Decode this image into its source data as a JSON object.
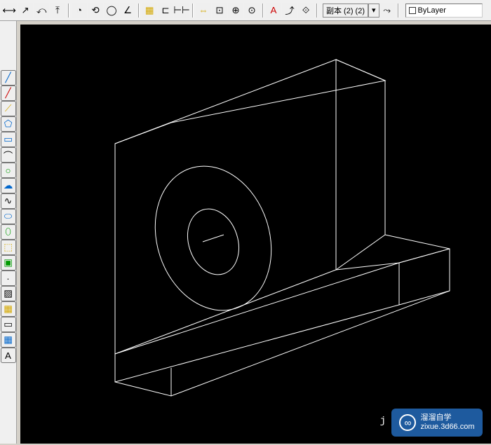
{
  "top_toolbar": {
    "buttons": [
      {
        "name": "dim-linear-icon",
        "glyph": "⟷"
      },
      {
        "name": "dim-aligned-icon",
        "glyph": "↗"
      },
      {
        "name": "dim-arc-icon",
        "glyph": "⤺"
      },
      {
        "name": "dim-ordinate-icon",
        "glyph": "⤒"
      },
      {
        "name": "dim-radius-icon",
        "glyph": "◔"
      },
      {
        "name": "dim-jogged-icon",
        "glyph": "⟲"
      },
      {
        "name": "dim-diameter-icon",
        "glyph": "◯"
      },
      {
        "name": "dim-angular-icon",
        "glyph": "∠"
      },
      {
        "name": "quick-dim-icon",
        "glyph": "▦"
      },
      {
        "name": "dim-baseline-icon",
        "glyph": "⊏"
      },
      {
        "name": "dim-continue-icon",
        "glyph": "⊢⊢"
      },
      {
        "name": "dim-space-icon",
        "glyph": "⇔"
      },
      {
        "name": "dim-break-icon",
        "glyph": "⊡"
      },
      {
        "name": "tolerance-icon",
        "glyph": "⊕"
      },
      {
        "name": "center-mark-icon",
        "glyph": "⊙"
      },
      {
        "name": "dim-edit-icon",
        "glyph": "A"
      },
      {
        "name": "dim-tedit-icon",
        "glyph": "⤴"
      },
      {
        "name": "dim-update-icon",
        "glyph": "⟐"
      }
    ],
    "style_dropdown": {
      "label": "副本 (2) (2)",
      "arrow": "▾"
    },
    "brush_btn": {
      "name": "dim-style-icon",
      "glyph": "⤳"
    },
    "layer_dropdown": {
      "label": "ByLayer",
      "arrow": "▾"
    }
  },
  "left_toolbar": {
    "buttons": [
      {
        "name": "line-icon",
        "glyph": "╱"
      },
      {
        "name": "construction-line-icon",
        "glyph": "╱"
      },
      {
        "name": "polyline-icon",
        "glyph": "⟋"
      },
      {
        "name": "polygon-icon",
        "glyph": "⬠"
      },
      {
        "name": "rectangle-icon",
        "glyph": "▭"
      },
      {
        "name": "arc-icon",
        "glyph": "⌒"
      },
      {
        "name": "circle-icon",
        "glyph": "○"
      },
      {
        "name": "revision-cloud-icon",
        "glyph": "☁"
      },
      {
        "name": "spline-icon",
        "glyph": "∿"
      },
      {
        "name": "ellipse-icon",
        "glyph": "⬭"
      },
      {
        "name": "ellipse-arc-icon",
        "glyph": "⬯"
      },
      {
        "name": "insert-block-icon",
        "glyph": "⬚"
      },
      {
        "name": "make-block-icon",
        "glyph": "▣"
      },
      {
        "name": "point-icon",
        "glyph": "·"
      },
      {
        "name": "hatch-icon",
        "glyph": "▨"
      },
      {
        "name": "gradient-icon",
        "glyph": "▦"
      },
      {
        "name": "region-icon",
        "glyph": "▭"
      },
      {
        "name": "table-icon",
        "glyph": "▦"
      },
      {
        "name": "text-icon",
        "glyph": "A"
      }
    ]
  },
  "watermark": {
    "logo_text": "∞",
    "title": "溜溜自学",
    "url": "zixue.3d66.com"
  },
  "canvas_label": "j"
}
